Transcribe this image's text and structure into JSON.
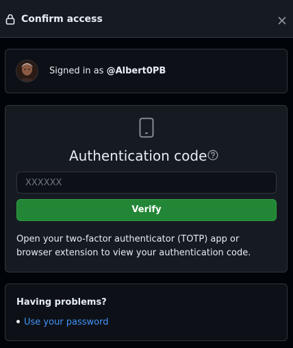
{
  "header": {
    "title": "Confirm access"
  },
  "account": {
    "signed_in_prefix": "Signed in as ",
    "username": "@Albert0PB"
  },
  "auth": {
    "title": "Authentication code",
    "input_placeholder": "XXXXXX",
    "input_value": "",
    "verify_label": "Verify",
    "help_text": "Open your two-factor authenticator (TOTP) app or browser extension to view your authentication code."
  },
  "problems": {
    "title": "Having problems?",
    "links": [
      {
        "label": "Use your password"
      }
    ]
  },
  "icons": {
    "header_icon": "lock-icon",
    "close_icon": "close-icon",
    "auth_icon": "device-mobile-icon",
    "help_icon": "question-icon"
  },
  "colors": {
    "primary_button": "#238636",
    "link": "#4493f8",
    "background": "#010409",
    "panel": "#161b22"
  }
}
